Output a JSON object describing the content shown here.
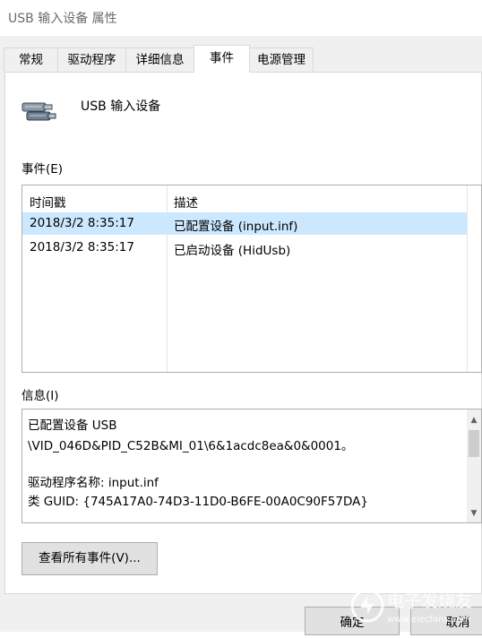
{
  "window": {
    "title": "USB 输入设备 属性"
  },
  "tabs": [
    {
      "label": "常规"
    },
    {
      "label": "驱动程序"
    },
    {
      "label": "详细信息"
    },
    {
      "label": "事件"
    },
    {
      "label": "电源管理"
    }
  ],
  "device": {
    "name": "USB 输入设备",
    "icon": "usb-device-icon"
  },
  "events": {
    "label": "事件(E)",
    "columns": {
      "timestamp": "时间戳",
      "description": "描述"
    },
    "rows": [
      {
        "timestamp": "2018/3/2 8:35:17",
        "description": "已配置设备 (input.inf)",
        "selected": true
      },
      {
        "timestamp": "2018/3/2 8:35:17",
        "description": "已启动设备 (HidUsb)",
        "selected": false
      }
    ]
  },
  "info": {
    "label": "信息(I)",
    "lines": [
      "已配置设备 USB",
      "\\VID_046D&PID_C52B&MI_01\\6&1acdc8ea&0&0001。",
      "",
      "驱动程序名称: input.inf",
      "类 GUID: {745A17A0-74D3-11D0-B6FE-00A0C90F57DA}"
    ]
  },
  "buttons": {
    "view_all": "查看所有事件(V)...",
    "ok": "确定",
    "cancel": "取消"
  },
  "watermark": {
    "text": "电子发烧友",
    "url": "www.elecfans.com"
  },
  "colors": {
    "selection": "#cce8ff",
    "dialog_bg": "#f0f0f0",
    "panel_bg": "#ffffff",
    "border": "#adadad"
  }
}
